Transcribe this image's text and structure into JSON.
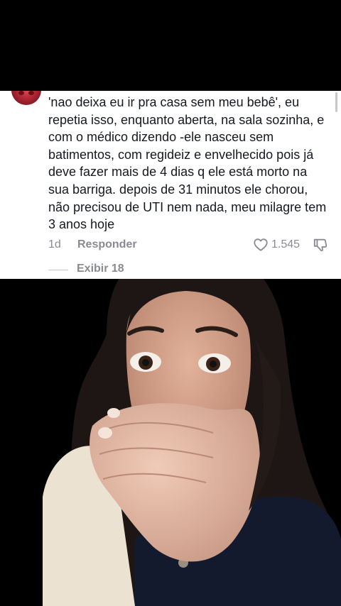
{
  "comment": {
    "text": "'nao deixa eu ir pra casa sem meu bebê', eu repetia isso, enquanto aberta, na sala sozinha, e com o médico dizendo -ele nasceu sem batimentos, com regideiz e envelhecido pois já deve fazer mais de 4 dias q ele está morto na sua barriga. depois de 31 minutos ele chorou, não precisou de UTI nem nada, meu milagre tem 3 anos hoje",
    "date": "1d",
    "reply_label": "Responder",
    "like_count": "1.545",
    "view_replies_label": "Exibir 18"
  },
  "icons": {
    "like": "heart-icon",
    "dislike": "thumbs-down-icon",
    "avatar": "avatar"
  },
  "colors": {
    "text": "#161823",
    "secondary": "#8a8b91",
    "background": "#ffffff"
  }
}
